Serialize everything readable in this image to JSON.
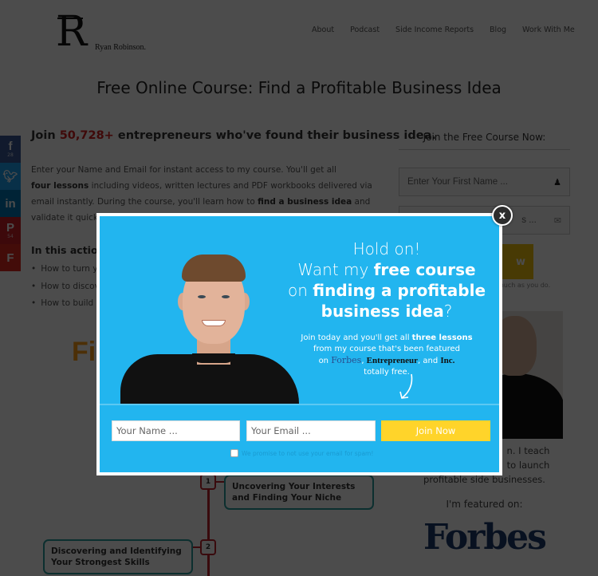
{
  "header": {
    "logo_letter": "R",
    "logo_name": "Ryan Robinson.",
    "nav": [
      "About",
      "Podcast",
      "Side Income Reports",
      "Blog",
      "Work With Me"
    ]
  },
  "page_title": "Free Online Course: Find a Profitable Business Idea",
  "social": [
    {
      "name": "facebook",
      "glyph": "f",
      "count": "28",
      "color": "#3b5998"
    },
    {
      "name": "twitter",
      "glyph": "t",
      "count": "",
      "color": "#1da1f2"
    },
    {
      "name": "linkedin",
      "glyph": "in",
      "count": "",
      "color": "#0077b5"
    },
    {
      "name": "pinterest",
      "glyph": "P",
      "count": "54",
      "color": "#cb2027"
    },
    {
      "name": "flipboard",
      "glyph": "F",
      "count": "",
      "color": "#e02a20"
    }
  ],
  "main": {
    "join_prefix": "Join ",
    "join_count": "50,728+",
    "join_suffix": " entrepreneurs who've found their business idea.",
    "intro_1": "Enter your Name and Email for instant access to my course. You'll get all",
    "intro_bold_1": "four lessons",
    "intro_2": " including videos, written lectures and PDF workbooks delivered via email instantly. During the course, you'll learn how to ",
    "intro_bold_2": "find a business idea",
    "intro_3": " and validate it quickly.",
    "action_heading": "In this action",
    "bullets": [
      "How to turn yo",
      "How to discove",
      "How to build a"
    ],
    "infographic_title": "Fi",
    "steps": [
      {
        "number": "1",
        "label_line1": "Uncovering Your Interests",
        "label_line2": "and Finding Your Niche"
      },
      {
        "number": "2",
        "label_line1": "Discovering and Identifying",
        "label_line2": "Your Strongest Skills"
      }
    ]
  },
  "sidebar": {
    "heading": "Join the Free Course Now:",
    "first_name_placeholder": "Enter Your First Name ...",
    "email_placeholder_visible": "s ...",
    "button_visible": "w",
    "note_visible": "much as you do.",
    "bio_line1": "n. I teach",
    "bio_line2": "to launch",
    "bio_line3": "profitable side businesses.",
    "featured_label": "I'm featured on:",
    "featured_logo": "Forbes"
  },
  "popup": {
    "line1": "Hold on!",
    "line2_plain": "Want my ",
    "line2_bold": "free course",
    "line3_plain": "on ",
    "line3_bold": "finding a profitable",
    "line4_bold": "business idea",
    "line4_plain": "?",
    "sub_1": "Join today and you'll get all ",
    "sub_bold": "three lessons",
    "sub_2": "from my course that's been featured",
    "sub_on": "on ",
    "brand_1": "Forbes",
    "brand_2": "Entrepreneur",
    "and": ", and ",
    "brand_3": "Inc.",
    "sub_end": "totally free.",
    "name_placeholder": "Your Name ...",
    "email_placeholder": "Your Email ...",
    "submit_label": "Join Now",
    "checkbox_label": "We promise to not use your email for spam!",
    "checkbox_checked": false,
    "close_label": "x",
    "colors": {
      "background": "#22b5ef",
      "button": "#ffd42a"
    }
  }
}
